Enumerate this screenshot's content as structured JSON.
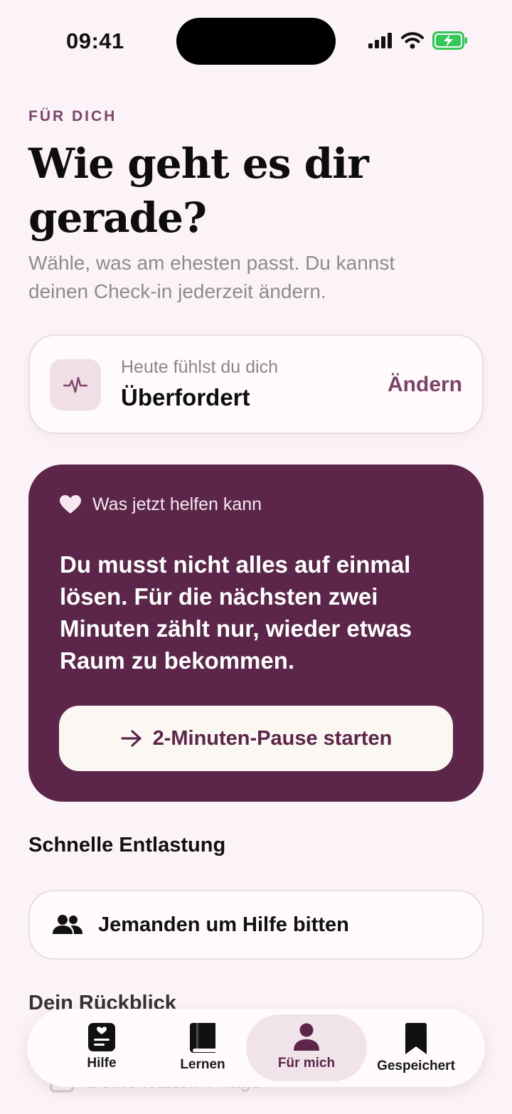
{
  "status_bar": {
    "time": "09:41"
  },
  "header": {
    "eyebrow": "FÜR DICH",
    "title": "Wie geht es dir gerade?",
    "subtitle": "Wähle, was am ehesten passt. Du kannst deinen Check-in jederzeit ändern."
  },
  "checkin": {
    "label": "Heute fühlst du dich",
    "value": "Überfordert",
    "change_label": "Ändern",
    "icon": "pulse-icon"
  },
  "help_card": {
    "header_label": "Was jetzt helfen kann",
    "header_icon": "heart-icon",
    "message": "Du musst nicht alles auf einmal lösen. Für die nächsten zwei Minuten zählt nur, wieder etwas Raum zu bekommen.",
    "button_label": "2-Minuten-Pause starten",
    "button_icon": "arrow-right-icon"
  },
  "quick_relief": {
    "title": "Schnelle Entlastung",
    "items": [
      {
        "label": "Jemanden um Hilfe bitten",
        "icon": "people-icon"
      }
    ]
  },
  "review": {
    "title": "Dein Rückblick",
    "row_label": "Deine letzten 7 Tage"
  },
  "tabbar": {
    "items": [
      {
        "label": "Hilfe",
        "icon": "help-card-icon",
        "active": false
      },
      {
        "label": "Lernen",
        "icon": "book-icon",
        "active": false
      },
      {
        "label": "Für mich",
        "icon": "person-icon",
        "active": true
      },
      {
        "label": "Gespeichert",
        "icon": "bookmark-icon",
        "active": false
      }
    ]
  },
  "colors": {
    "background": "#fcf3f8",
    "accent": "#7c4468",
    "card_dark": "#5b2649",
    "battery": "#34c759"
  }
}
